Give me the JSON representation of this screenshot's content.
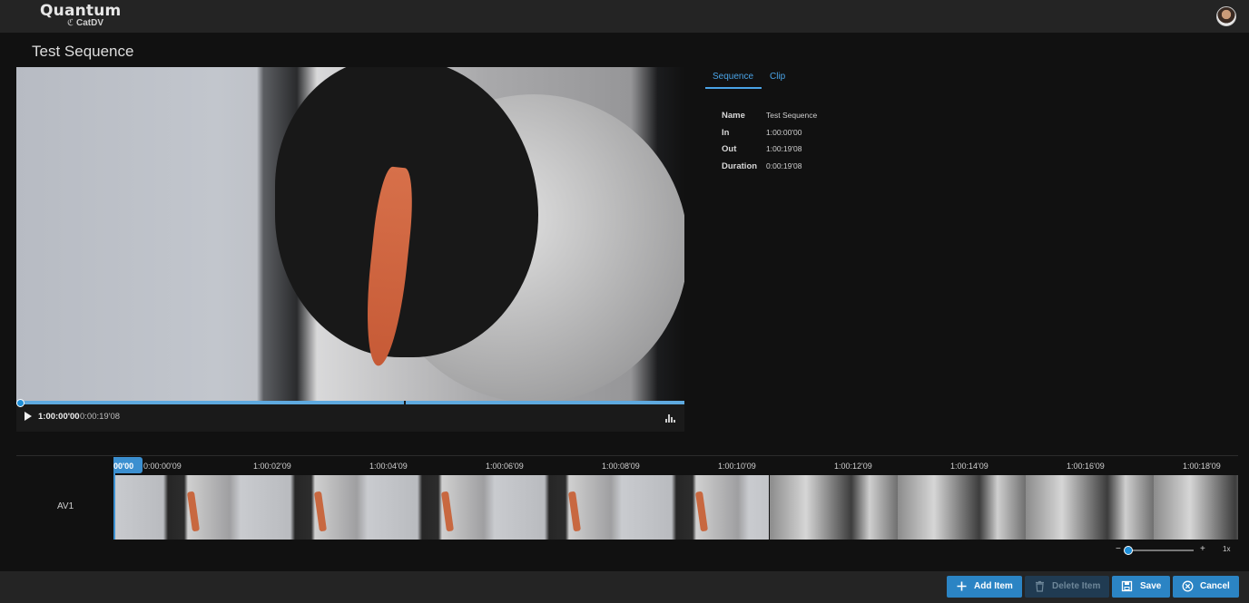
{
  "brand": {
    "name": "Quantum",
    "product": "CatDV"
  },
  "page": {
    "title": "Test Sequence"
  },
  "player": {
    "current_time": "1:00:00'00",
    "duration": "0:00:19'08",
    "scrub_progress": 0.0
  },
  "tabs": [
    {
      "label": "Sequence",
      "active": true
    },
    {
      "label": "Clip",
      "active": false
    }
  ],
  "properties": [
    {
      "label": "Name",
      "value": "Test Sequence"
    },
    {
      "label": "In",
      "value": "1:00:00'00"
    },
    {
      "label": "Out",
      "value": "1:00:19'08"
    },
    {
      "label": "Duration",
      "value": "0:00:19'08"
    }
  ],
  "timeline": {
    "track_label": "AV1",
    "playhead_label": "00'00",
    "ruler_ticks": [
      "0:00:00'09",
      "1:00:02'09",
      "1:00:04'09",
      "1:00:06'09",
      "1:00:08'09",
      "1:00:10'09",
      "1:00:12'09",
      "1:00:14'09",
      "1:00:16'09",
      "1:00:18'09"
    ],
    "zoom": {
      "minus": "−",
      "plus": "+",
      "level": "1x"
    }
  },
  "buttons": {
    "add": "Add Item",
    "delete": "Delete Item",
    "save": "Save",
    "cancel": "Cancel"
  },
  "colors": {
    "accent": "#2b84c4",
    "tab_active": "#4aa3e6",
    "disabled_button": "#203b52"
  },
  "icons": [
    "user-avatar",
    "play-icon",
    "levels-icon",
    "plus-icon",
    "trash-icon",
    "floppy-icon",
    "cancel-circle-icon"
  ]
}
